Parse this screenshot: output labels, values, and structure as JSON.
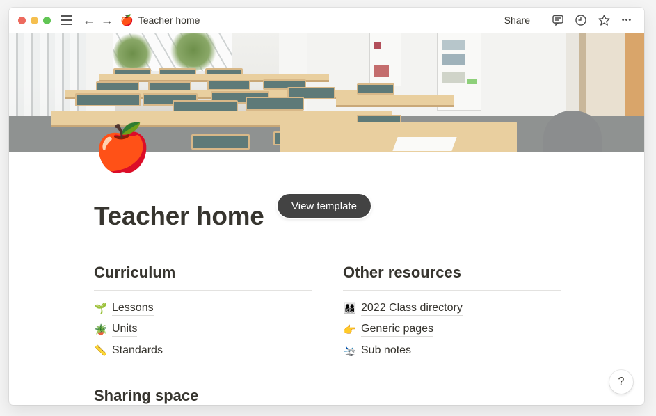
{
  "window": {
    "traffic_lights": [
      {
        "name": "close",
        "color": "#ed6a5e"
      },
      {
        "name": "minimize",
        "color": "#f5bf4f"
      },
      {
        "name": "maximize",
        "color": "#61c554"
      }
    ]
  },
  "titlebar": {
    "menu_icon": "hamburger-icon",
    "back_icon": "←",
    "forward_icon": "→",
    "page_emoji": "🍎",
    "breadcrumb": "Teacher home",
    "share_label": "Share",
    "icons": [
      "comment-icon",
      "clock-icon",
      "star-icon",
      "more-icon"
    ],
    "more_glyph": "•••"
  },
  "page": {
    "icon": "🍎",
    "title": "Teacher home",
    "view_template_label": "View template",
    "sections": {
      "curriculum": {
        "heading": "Curriculum",
        "items": [
          {
            "emoji": "🌱",
            "label": "Lessons"
          },
          {
            "emoji": "🪴",
            "label": "Units"
          },
          {
            "emoji": "📏",
            "label": "Standards"
          }
        ]
      },
      "other_resources": {
        "heading": "Other resources",
        "items": [
          {
            "emoji": "👨‍👩‍👧‍👦",
            "label": "2022 Class directory"
          },
          {
            "emoji": "👉",
            "label": "Generic pages"
          },
          {
            "emoji": "🛬",
            "label": "Sub notes"
          }
        ]
      },
      "sharing_space": {
        "heading": "Sharing space"
      }
    },
    "help_label": "?"
  }
}
